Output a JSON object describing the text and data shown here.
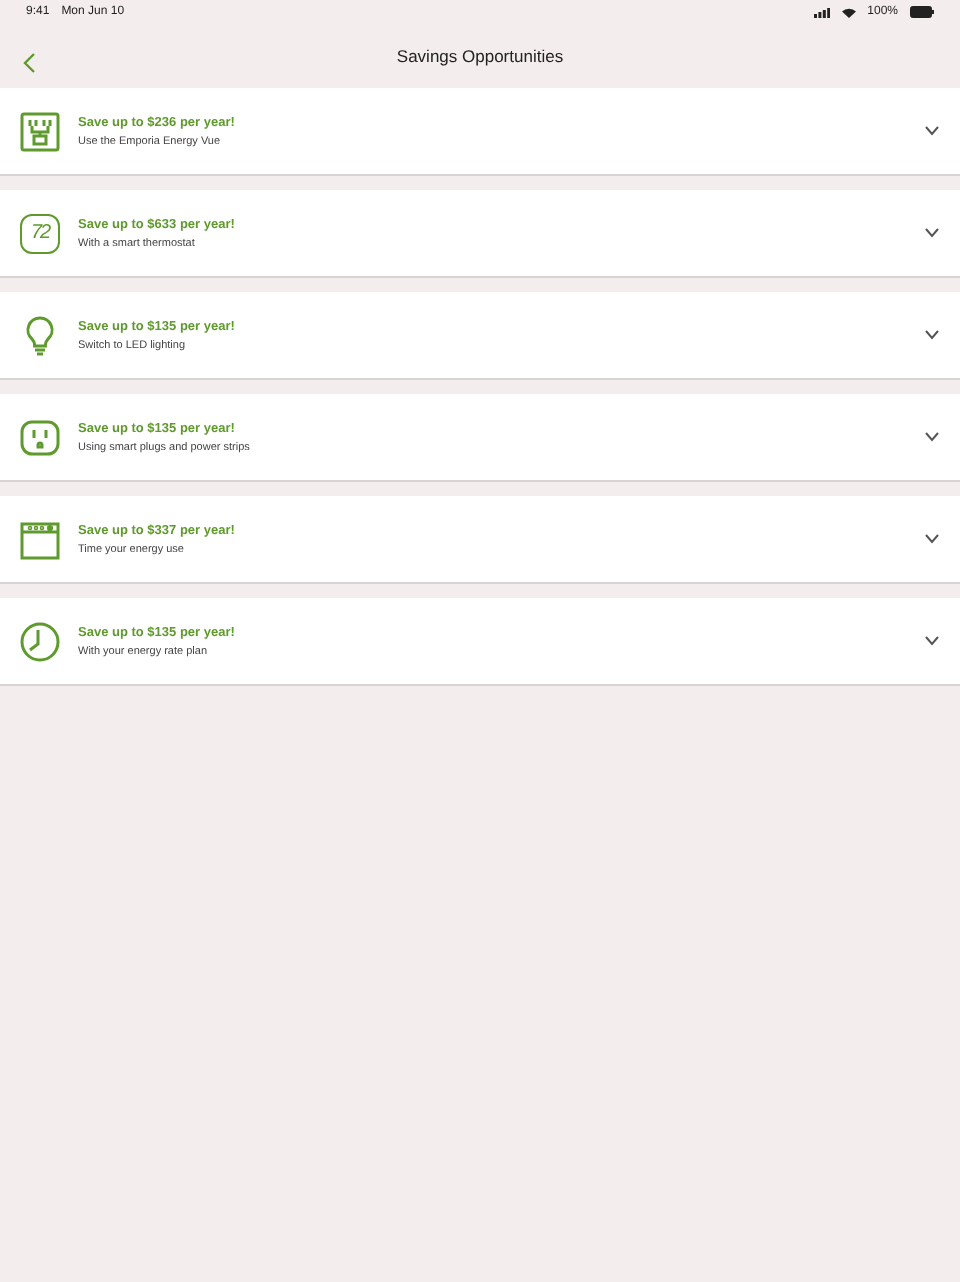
{
  "status_bar": {
    "time": "9:41",
    "date": "Mon Jun 10",
    "battery": "100%"
  },
  "nav": {
    "title": "Savings Opportunities"
  },
  "items": [
    {
      "kind": "monitor",
      "title": "Save up to $236 per year!",
      "subtitle": "Use the Emporia Energy Vue",
      "expanded": false
    },
    {
      "kind": "thermostat",
      "icon_label": "72",
      "title": "Save up to $633 per year!",
      "subtitle": "With a smart thermostat",
      "expanded": false
    },
    {
      "kind": "bulb",
      "title": "Save up to $135 per year!",
      "subtitle": "Switch to LED lighting",
      "expanded": false
    },
    {
      "kind": "outlet",
      "title": "Save up to $135 per year!",
      "subtitle": "Using smart plugs and power strips",
      "expanded": false
    },
    {
      "kind": "appliance",
      "title": "Save up to $337 per year!",
      "subtitle": "Time your energy use",
      "expanded": false
    },
    {
      "kind": "clock",
      "title": "Save up to $135 per year!",
      "subtitle": "With your energy rate plan",
      "expanded": false
    }
  ]
}
